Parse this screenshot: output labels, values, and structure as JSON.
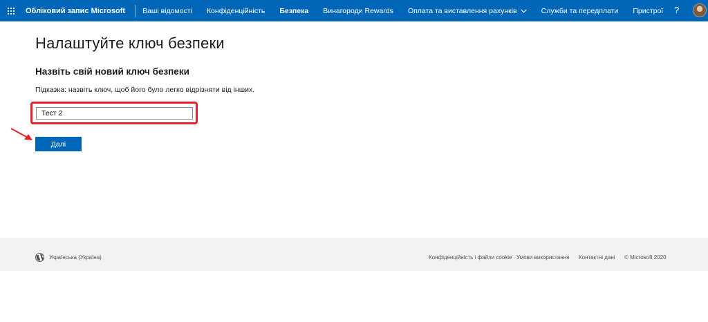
{
  "header": {
    "brand": "Обліковий запис Microsoft",
    "nav": [
      {
        "label": "Ваші відомості"
      },
      {
        "label": "Конфіденційність"
      },
      {
        "label": "Безпека"
      },
      {
        "label": "Винагороди Rewards"
      },
      {
        "label": "Оплата та виставлення рахунків"
      },
      {
        "label": "Служби та передплати"
      },
      {
        "label": "Пристрої"
      }
    ],
    "active_tab": "Безпека",
    "help_label": "?"
  },
  "main": {
    "title": "Налаштуйте ключ безпеки",
    "subtitle": "Назвіть свій новий ключ безпеки",
    "hint": "Підказка: назвіть ключ, щоб його було легко відрізняти від інших.",
    "key_name_value": "Тест 2",
    "next_label": "Далі"
  },
  "footer": {
    "locale": "Українська (Україна)",
    "links": [
      {
        "label": "Конфіденційність і файли cookie"
      },
      {
        "label": "Умови використання"
      },
      {
        "label": "Контактні дані"
      }
    ],
    "copyright": "© Microsoft 2020"
  },
  "colors": {
    "brand_blue": "#0067b8",
    "highlight_red": "#e3202b",
    "footer_bg": "#f2f2f2"
  },
  "icons": [
    "waffle-icon",
    "chevron-down-icon",
    "help-icon",
    "avatar",
    "arrow-annotation-icon",
    "globe-icon"
  ]
}
